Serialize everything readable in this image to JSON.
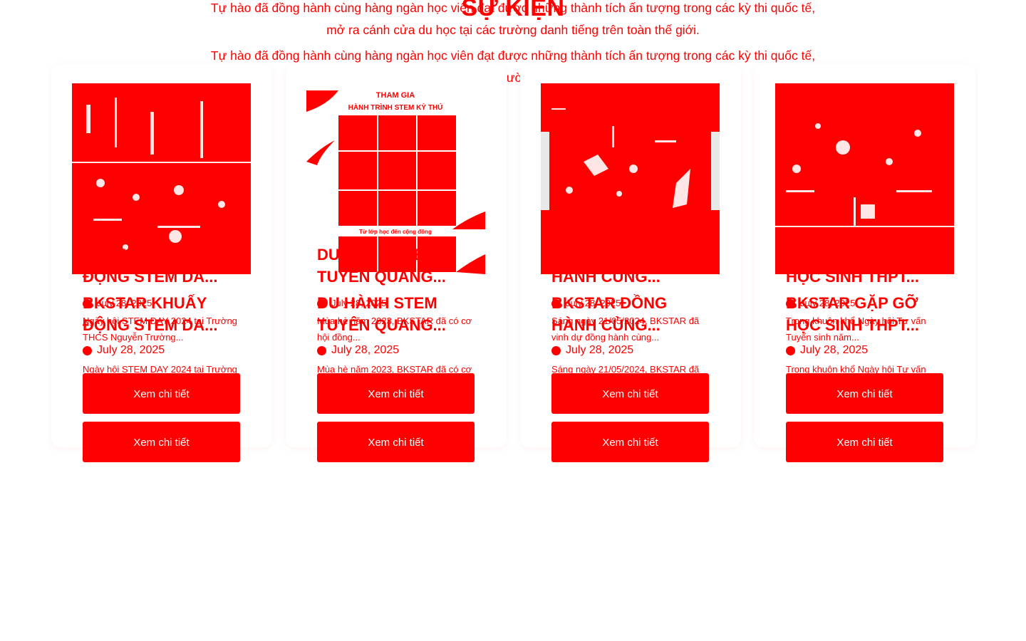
{
  "section": {
    "title": "SỰ KIỆN",
    "subtitle_line1": "Tự hào đã đồng hành cùng hàng ngàn học viên đạt được những thành tích ấn tượng trong các kỳ thi quốc tế,",
    "subtitle_line2": "mở ra cánh cửa du học tại các trường danh tiếng trên toàn thế giới."
  },
  "accent_color": "#ff0000",
  "cards": [
    {
      "title": "BKSTAR KHUẤY ĐỘNG STEM DA...",
      "date": "July 28, 2025",
      "description": "Ngày hội STEM DAY 2024 tại Trường THCS Nguyễn Trường...",
      "button": "Xem chi tiết",
      "image_text": "",
      "icon": "calendar-dot-icon"
    },
    {
      "title": "DU HÀNH STEM TUYÊN QUANG...",
      "date": "July 28, 2025",
      "description": "Mùa hè năm 2023, BKSTAR đã có cơ hội đồng...",
      "button": "Xem chi tiết",
      "image_text": "THAM GIA HÀNH TRÌNH STEM KỲ THÚ",
      "image_caption": "Từ lớp học đến cộng đồng",
      "icon": "calendar-dot-icon"
    },
    {
      "title": "BKSTAR ĐỒNG HÀNH CÙNG...",
      "date": "July 28, 2025",
      "description": "Sáng ngày 21/05/2024, BKSTAR đã vinh dự đồng hành cùng...",
      "button": "Xem chi tiết",
      "image_text": "",
      "icon": "calendar-dot-icon"
    },
    {
      "title": "BKSTAR GẶP GỠ HỌC SINH THPT...",
      "date": "July 28, 2025",
      "description": "Trong khuôn khổ Ngày hội Tư vấn Tuyển sinh năm...",
      "button": "Xem chi tiết",
      "image_text": "",
      "icon": "calendar-dot-icon"
    }
  ]
}
